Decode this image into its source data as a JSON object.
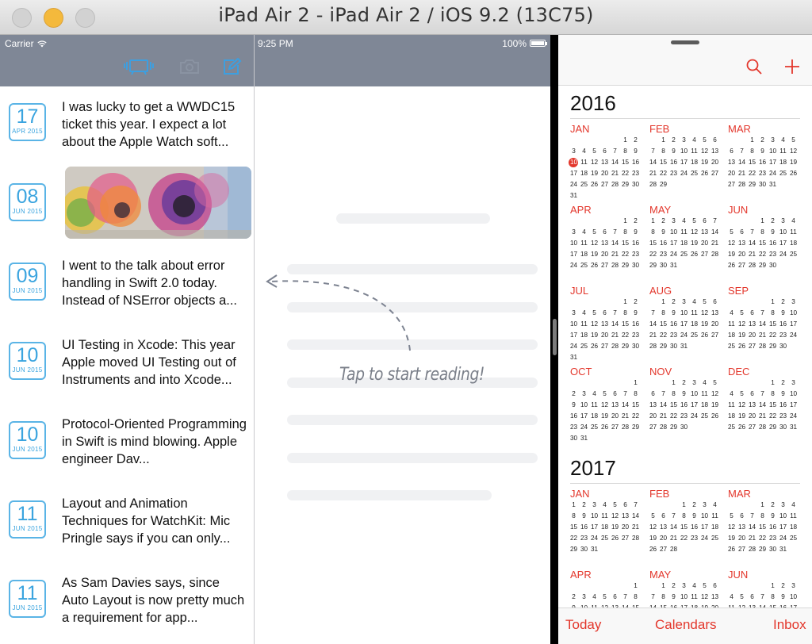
{
  "window": {
    "title": "iPad Air 2 - iPad Air 2 / iOS 9.2 (13C75)"
  },
  "status_bar": {
    "carrier": "Carrier",
    "time": "9:25 PM",
    "battery": "100%"
  },
  "list": {
    "items": [
      {
        "day": "17",
        "month": "APR 2015",
        "text": "I was lucky to get a WWDC15 ticket this year. I expect a lot about the Apple Watch soft...",
        "has_image": false
      },
      {
        "day": "08",
        "month": "JUN 2015",
        "text": "",
        "has_image": true
      },
      {
        "day": "09",
        "month": "JUN 2015",
        "text": "I went to the talk about error handling in Swift 2.0 today. Instead of NSError objects a...",
        "has_image": false
      },
      {
        "day": "10",
        "month": "JUN 2015",
        "text": "UI Testing in Xcode: This year Apple moved UI Testing out of Instruments and into Xcode...",
        "has_image": false
      },
      {
        "day": "10",
        "month": "JUN 2015",
        "text": "Protocol-Oriented Programming in Swift is mind blowing. Apple engineer Dav...",
        "has_image": false
      },
      {
        "day": "11",
        "month": "JUN 2015",
        "text": "Layout and Animation Techniques for WatchKit: Mic Pringle says if you can only...",
        "has_image": false
      },
      {
        "day": "11",
        "month": "JUN 2015",
        "text": "As Sam Davies says, since Auto Layout is now pretty much a requirement for app...",
        "has_image": false
      }
    ]
  },
  "detail": {
    "placeholder": "Tap to start reading!"
  },
  "calendar": {
    "accent": "#e3372c",
    "today": {
      "year": "2016",
      "month": "JAN",
      "day": 10
    },
    "years": [
      {
        "year": "2016",
        "months": [
          {
            "name": "JAN",
            "offset": 5,
            "days": 31
          },
          {
            "name": "FEB",
            "offset": 1,
            "days": 29
          },
          {
            "name": "MAR",
            "offset": 2,
            "days": 31
          },
          {
            "name": "APR",
            "offset": 5,
            "days": 30
          },
          {
            "name": "MAY",
            "offset": 0,
            "days": 31
          },
          {
            "name": "JUN",
            "offset": 3,
            "days": 30
          },
          {
            "name": "JUL",
            "offset": 5,
            "days": 31
          },
          {
            "name": "AUG",
            "offset": 1,
            "days": 31
          },
          {
            "name": "SEP",
            "offset": 4,
            "days": 30
          },
          {
            "name": "OCT",
            "offset": 6,
            "days": 31
          },
          {
            "name": "NOV",
            "offset": 2,
            "days": 30
          },
          {
            "name": "DEC",
            "offset": 4,
            "days": 31
          }
        ]
      },
      {
        "year": "2017",
        "months": [
          {
            "name": "JAN",
            "offset": 0,
            "days": 31
          },
          {
            "name": "FEB",
            "offset": 3,
            "days": 28
          },
          {
            "name": "MAR",
            "offset": 3,
            "days": 31
          },
          {
            "name": "APR",
            "offset": 6,
            "days": 30
          },
          {
            "name": "MAY",
            "offset": 1,
            "days": 31
          },
          {
            "name": "JUN",
            "offset": 4,
            "days": 30
          }
        ]
      }
    ],
    "tabs": {
      "today": "Today",
      "calendars": "Calendars",
      "inbox": "Inbox"
    }
  }
}
